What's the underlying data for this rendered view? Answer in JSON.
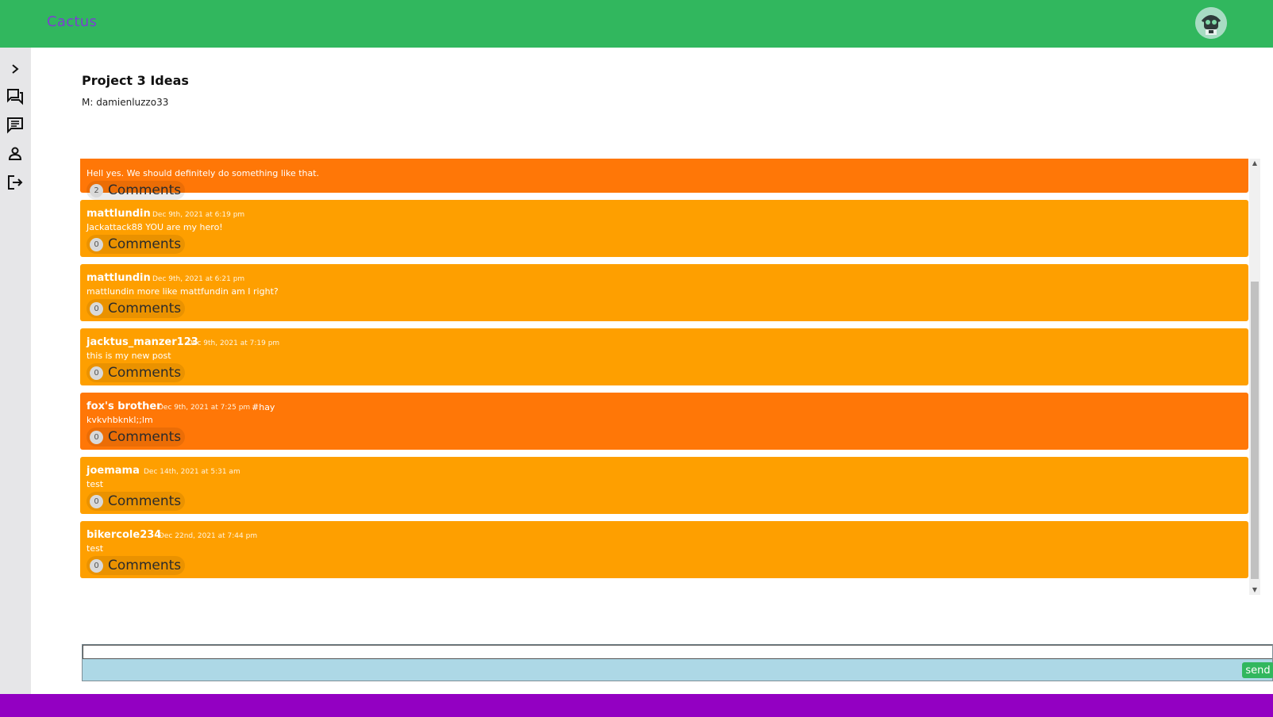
{
  "app": {
    "brand": "Cactus",
    "accent": "#31b75e",
    "footer_color": "#9300c2"
  },
  "sidebar": {
    "items": [
      {
        "icon": "chevron-right-icon"
      },
      {
        "icon": "forum-icon"
      },
      {
        "icon": "chat-icon"
      },
      {
        "icon": "person-icon"
      },
      {
        "icon": "logout-icon"
      }
    ]
  },
  "thread": {
    "title": "Project 3 Ideas",
    "moderator": "M: damienluzzo33"
  },
  "posts": [
    {
      "user": "",
      "date": "",
      "tag": "",
      "body": "Hell yes. We should definitely do something like that.",
      "comment_count": "2",
      "comments_label": "Comments"
    },
    {
      "user": "mattlundin",
      "date": "Dec 9th, 2021 at 6:19 pm",
      "tag": "",
      "body": "Jackattack88 YOU are my hero!",
      "comment_count": "0",
      "comments_label": "Comments"
    },
    {
      "user": "mattlundin",
      "date": "Dec 9th, 2021 at 6:21 pm",
      "tag": "",
      "body": "mattlundin more like mattfundin am I right?",
      "comment_count": "0",
      "comments_label": "Comments"
    },
    {
      "user": "jacktus_manzer123",
      "date": "Dec 9th, 2021 at 7:19 pm",
      "tag": "",
      "body": "this is my new post",
      "comment_count": "0",
      "comments_label": "Comments"
    },
    {
      "user": "fox's brother",
      "date": "Dec 9th, 2021 at 7:25 pm",
      "tag": "#hay",
      "body": "kvkvhbknkl;;lm",
      "comment_count": "0",
      "comments_label": "Comments"
    },
    {
      "user": "joemama",
      "date": "Dec 14th, 2021 at 5:31 am",
      "tag": "",
      "body": "test",
      "comment_count": "0",
      "comments_label": "Comments"
    },
    {
      "user": "bikercole234",
      "date": "Dec 22nd, 2021 at 7:44 pm",
      "tag": "",
      "body": "test",
      "comment_count": "0",
      "comments_label": "Comments"
    }
  ],
  "composer": {
    "value": "",
    "send_label": "send"
  }
}
